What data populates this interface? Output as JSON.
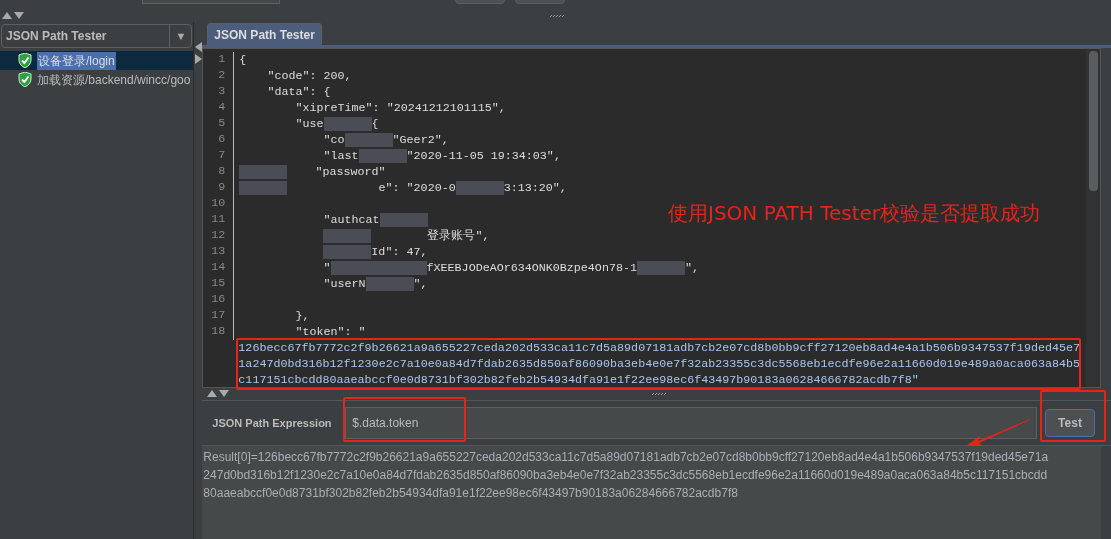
{
  "sidebar": {
    "dropdown": "JSON Path Tester",
    "dropdown_arrow": "▼",
    "items": [
      {
        "label": "设备登录/login",
        "selected": true
      },
      {
        "label": "加载资源/backend/wincc/goo",
        "selected": false
      }
    ]
  },
  "tab": {
    "label": "JSON Path Tester",
    "selected": true
  },
  "editor": {
    "lines": [
      {
        "number": "1",
        "segments": [
          {
            "kind": "text",
            "text": "{"
          }
        ]
      },
      {
        "number": "2",
        "segments": [
          {
            "kind": "text",
            "text": "    \"code\": 200,"
          }
        ]
      },
      {
        "number": "3",
        "segments": [
          {
            "kind": "text",
            "text": "    \"data\": {"
          }
        ]
      },
      {
        "number": "4",
        "segments": [
          {
            "kind": "text",
            "text": "        \"xipreTime\": \"20241212101115\","
          }
        ]
      },
      {
        "number": "5",
        "segments": [
          {
            "kind": "text",
            "text": "        \"use"
          },
          {
            "kind": "redacted"
          },
          {
            "kind": "text",
            "text": "{"
          }
        ]
      },
      {
        "number": "6",
        "segments": [
          {
            "kind": "text",
            "text": "            \"co"
          },
          {
            "kind": "redacted"
          },
          {
            "kind": "text",
            "text": "\"Geer2\","
          }
        ]
      },
      {
        "number": "7",
        "segments": [
          {
            "kind": "text",
            "text": "            \"last"
          },
          {
            "kind": "redacted"
          },
          {
            "kind": "text",
            "text": "\"2020-11-05 19:34:03\","
          }
        ]
      },
      {
        "number": "8",
        "segments": [
          {
            "kind": "redacted"
          },
          {
            "kind": "text",
            "text": "    \"password\""
          }
        ]
      },
      {
        "number": "9",
        "segments": [
          {
            "kind": "redacted"
          },
          {
            "kind": "text",
            "text": "             e\": \"2020-0"
          },
          {
            "kind": "redacted"
          },
          {
            "kind": "text",
            "text": "3:13:20\","
          }
        ]
      },
      {
        "number": "10"
      },
      {
        "number": "11",
        "segments": [
          {
            "kind": "text",
            "text": "            \"authcat"
          },
          {
            "kind": "redacted"
          }
        ]
      },
      {
        "number": "12",
        "segments": [
          {
            "kind": "indent"
          },
          {
            "kind": "redacted"
          },
          {
            "kind": "text",
            "text": "        登录账号\","
          }
        ]
      },
      {
        "number": "13",
        "segments": [
          {
            "kind": "indent"
          },
          {
            "kind": "redacted"
          },
          {
            "kind": "text",
            "text": "Id\": 47,"
          }
        ]
      },
      {
        "number": "14",
        "segments": [
          {
            "kind": "text",
            "text": "            \""
          },
          {
            "kind": "redacted"
          },
          {
            "kind": "redacted"
          },
          {
            "kind": "text",
            "text": "fXEEBJODeAOr634ONK0Bzpe4On78-1"
          },
          {
            "kind": "redacted"
          },
          {
            "kind": "text",
            "text": "\","
          }
        ]
      },
      {
        "number": "15",
        "segments": [
          {
            "kind": "text",
            "text": "            \"userN"
          },
          {
            "kind": "redacted"
          },
          {
            "kind": "text",
            "text": "\","
          }
        ]
      },
      {
        "number": "16"
      },
      {
        "number": "17",
        "segments": [
          {
            "kind": "text",
            "text": "        },"
          }
        ]
      },
      {
        "number": "18",
        "segments": [
          {
            "kind": "text",
            "text": "        \"token\": \""
          }
        ]
      }
    ],
    "wrapped": [
      "126becc67fb7772c2f9b26621a9a655227ceda202d533ca11c7d5a89d07181adb7cb2e07cd8b0bb9cff27120eb8ad4e4a1b506b9347537f19ded45e7",
      "1a247d0bd316b12f1230e2c7a10e0a84d7fdab2635d850af86090ba3eb4e0e7f32ab23355c3dc5568eb1ecdfe96e2a11660d019e489a0aca063a84b5",
      "c117151cbcdd80aaeabccf0e0d8731bf302b82feb2b54934dfa91e1f22ee98ec6f43497b90183a06284666782acdb7f8\""
    ]
  },
  "expression": {
    "label": "JSON Path Expression",
    "value": "$.data.token",
    "button": "Test"
  },
  "result": [
    "Result[0]=126becc67fb7772c2f9b26621a9a655227ceda202d533ca11c7d5a89d07181adb7cb2e07cd8b0bb9cff27120eb8ad4e4a1b506b9347537f19ded45e71a",
    "247d0bd316b12f1230e2c7a10e0a84d7fdab2635d850af86090ba3eb4e0e7f32ab23355c3dc5568eb1ecdfe96e2a11660d019e489a0aca063a84b5c117151cbcdd",
    "80aaeabccf0e0d8731bf302b82feb2b54934dfa91e1f22ee98ec6f43497b90183a06284666782acdb7f8"
  ],
  "annotation": {
    "note": "使用JSON PATH Tester校验是否提取成功"
  }
}
